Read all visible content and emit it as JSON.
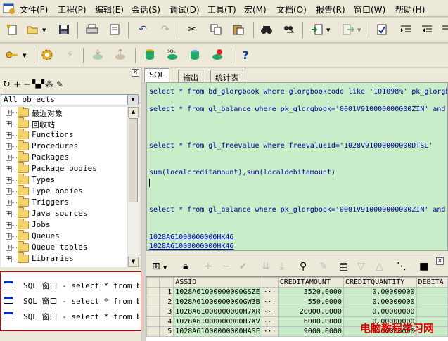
{
  "menu": [
    "文件(F)",
    "工程(P)",
    "编辑(E)",
    "会话(S)",
    "调试(D)",
    "工具(T)",
    "宏(M)",
    "文档(O)",
    "报告(R)",
    "窗口(W)",
    "帮助(H)"
  ],
  "object_selector": "All objects",
  "tree_items": [
    "最近对象",
    "回收站",
    "Functions",
    "Procedures",
    "Packages",
    "Package bodies",
    "Types",
    "Type bodies",
    "Triggers",
    "Java sources",
    "Jobs",
    "Queues",
    "Queue tables",
    "Libraries"
  ],
  "windows": [
    "SQL 窗口 - select * from bd_",
    "SQL 窗口 - select * from bd_",
    "SQL 窗口 - select * from bd_"
  ],
  "tabs": [
    "SQL",
    "输出",
    "统计表"
  ],
  "code_lines": [
    {
      "text": "select * from bd_glorgbook where glorgbookcode like '101098%' pk_glorgb"
    },
    {
      "text": "select * from gl_balance where pk_glorgbook='0001V910000000000ZIN' and"
    },
    {
      "text": "select * from gl_freevalue where freevalueid='1028V91000000000DTSL'"
    },
    {
      "text": "sum(localcreditamount),sum(localdebitamount)"
    },
    {
      "text": "select *  from gl_balance where pk_glorgbook='0001V910000000000ZIN' and"
    }
  ],
  "result_links": [
    "1028A61000000000HK46",
    "1028A61000000000HK46"
  ],
  "grid": {
    "columns": [
      "ASSID",
      "CREDITAMOUNT",
      "CREDITQUANTITY",
      "DEBITA"
    ],
    "rows": [
      {
        "n": "1",
        "assid": "1028A61000000000GSZE",
        "credit": "3520.0000",
        "qty": "0.00000000"
      },
      {
        "n": "2",
        "assid": "1028A61000000000GW3B",
        "credit": "550.0000",
        "qty": "0.00000000"
      },
      {
        "n": "3",
        "assid": "1028A61000000000H7XR",
        "credit": "20000.0000",
        "qty": "0.00000000"
      },
      {
        "n": "4",
        "assid": "1028A61000000000H7XV",
        "credit": "6000.0000",
        "qty": "0.00000000"
      },
      {
        "n": "5",
        "assid": "1028A61000000000HASE",
        "credit": "9000.0000",
        "qty": "0.00000000"
      }
    ]
  },
  "watermark": "电脑教程学习网"
}
